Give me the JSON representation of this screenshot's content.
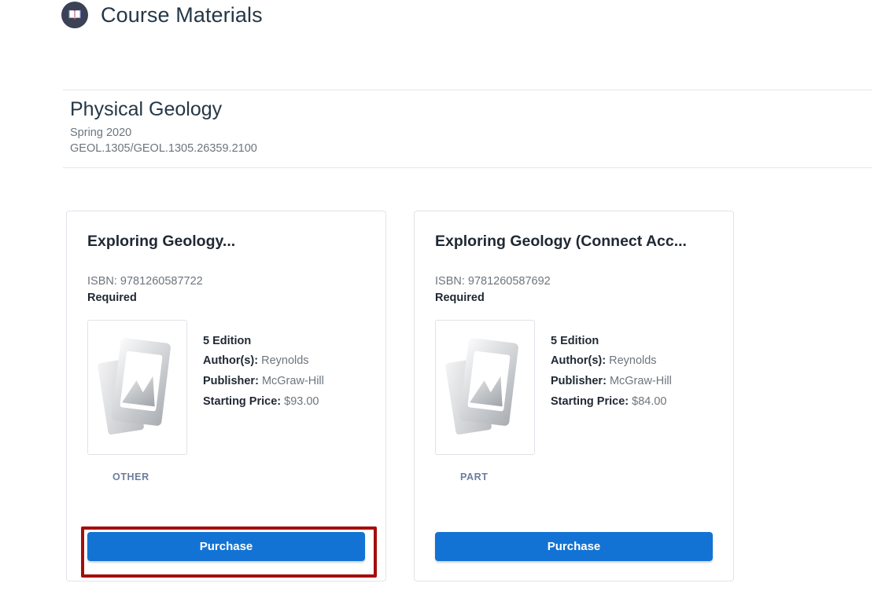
{
  "header": {
    "title": "Course Materials",
    "icon": "open-book-icon"
  },
  "course": {
    "name": "Physical Geology",
    "term": "Spring 2020",
    "code": "GEOL.1305/GEOL.1305.26359.2100"
  },
  "colors": {
    "accent_blue": "#1273d4",
    "header_icon_bg": "#3b4256",
    "title_navy": "#253746",
    "muted_gray": "#6d757e",
    "badge_blue_gray": "#6b7f9e",
    "highlight_red": "#a50d0d",
    "card_border": "#dfe3e8"
  },
  "materials": [
    {
      "title": "Exploring Geology...",
      "isbn_label": "ISBN: 9781260587722",
      "requirement": "Required",
      "thumbnail": "image-placeholder-icon",
      "edition": "5 Edition",
      "author_label": "Author(s):",
      "author_value": "Reynolds",
      "publisher_label": "Publisher:",
      "publisher_value": "McGraw-Hill",
      "price_label": "Starting Price:",
      "price_value": "$93.00",
      "badge": "OTHER",
      "purchase_label": "Purchase",
      "highlighted": true
    },
    {
      "title": "Exploring Geology (Connect Acc...",
      "isbn_label": "ISBN: 9781260587692",
      "requirement": "Required",
      "thumbnail": "image-placeholder-icon",
      "edition": "5 Edition",
      "author_label": "Author(s):",
      "author_value": "Reynolds",
      "publisher_label": "Publisher:",
      "publisher_value": "McGraw-Hill",
      "price_label": "Starting Price:",
      "price_value": "$84.00",
      "badge": "PART",
      "purchase_label": "Purchase",
      "highlighted": false
    }
  ]
}
